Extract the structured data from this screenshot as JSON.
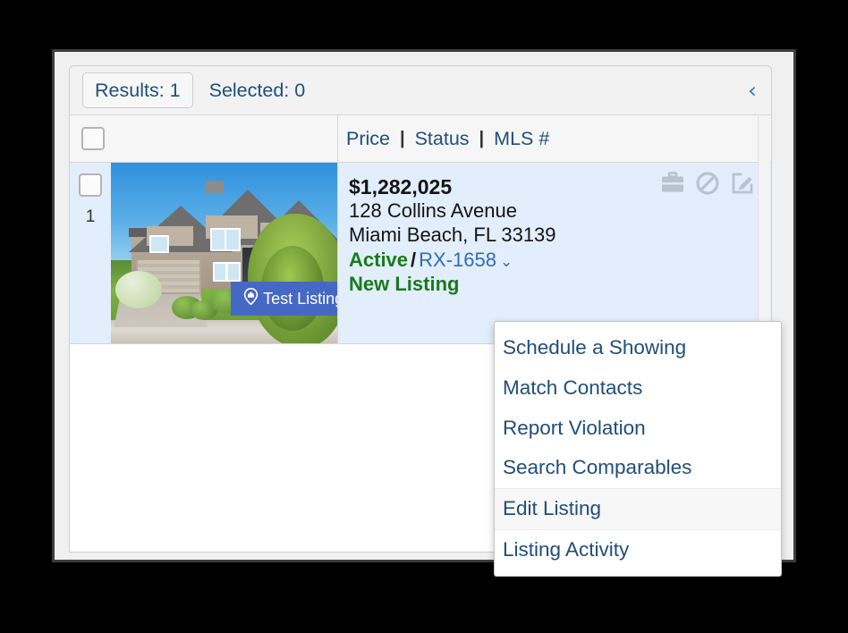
{
  "toolbar": {
    "results_label": "Results: 1",
    "selected_label": "Selected: 0",
    "collapse_icon": "chevron-left-icon",
    "collapse_glyph": "‹"
  },
  "columns": {
    "select_all_icon": "checkbox-unchecked-icon",
    "headers": [
      "Price",
      "Status",
      "MLS #"
    ],
    "separator": "|"
  },
  "listing": {
    "index": "1",
    "row_checkbox_icon": "checkbox-unchecked-icon",
    "photo": {
      "alt_name": "property-photo",
      "badge_text": "Test Listing",
      "badge_icon": "home-pin-icon",
      "badge_color": "#4668c5"
    },
    "price": "$1,282,025",
    "address_line1": "128 Collins Avenue",
    "address_line2": "Miami Beach, FL 33139",
    "status": "Active",
    "status_color": "#1a7a1a",
    "separator": "/",
    "mls_number": "RX-1658",
    "mls_caret_glyph": "⌄",
    "new_listing_flag": "New Listing",
    "action_icons": [
      {
        "name": "briefcase-icon",
        "title": "Briefcase"
      },
      {
        "name": "prohibited-icon",
        "title": "Prohibited"
      },
      {
        "name": "edit-square-icon",
        "title": "Edit"
      }
    ]
  },
  "context_menu": {
    "items": [
      {
        "label": "Schedule a Showing",
        "hovered": false
      },
      {
        "label": "Match Contacts",
        "hovered": false
      },
      {
        "label": "Report Violation",
        "hovered": false
      },
      {
        "label": "Search Comparables",
        "hovered": false
      },
      {
        "label": "Edit Listing",
        "hovered": true
      },
      {
        "label": "Listing Activity",
        "hovered": false
      }
    ]
  },
  "colors": {
    "accent_blue": "#1f4e79",
    "link_blue": "#2c6fb5",
    "row_selected_bg": "#e2eefb",
    "status_green": "#1a7a1a",
    "frame_border": "#3d3d3d"
  }
}
